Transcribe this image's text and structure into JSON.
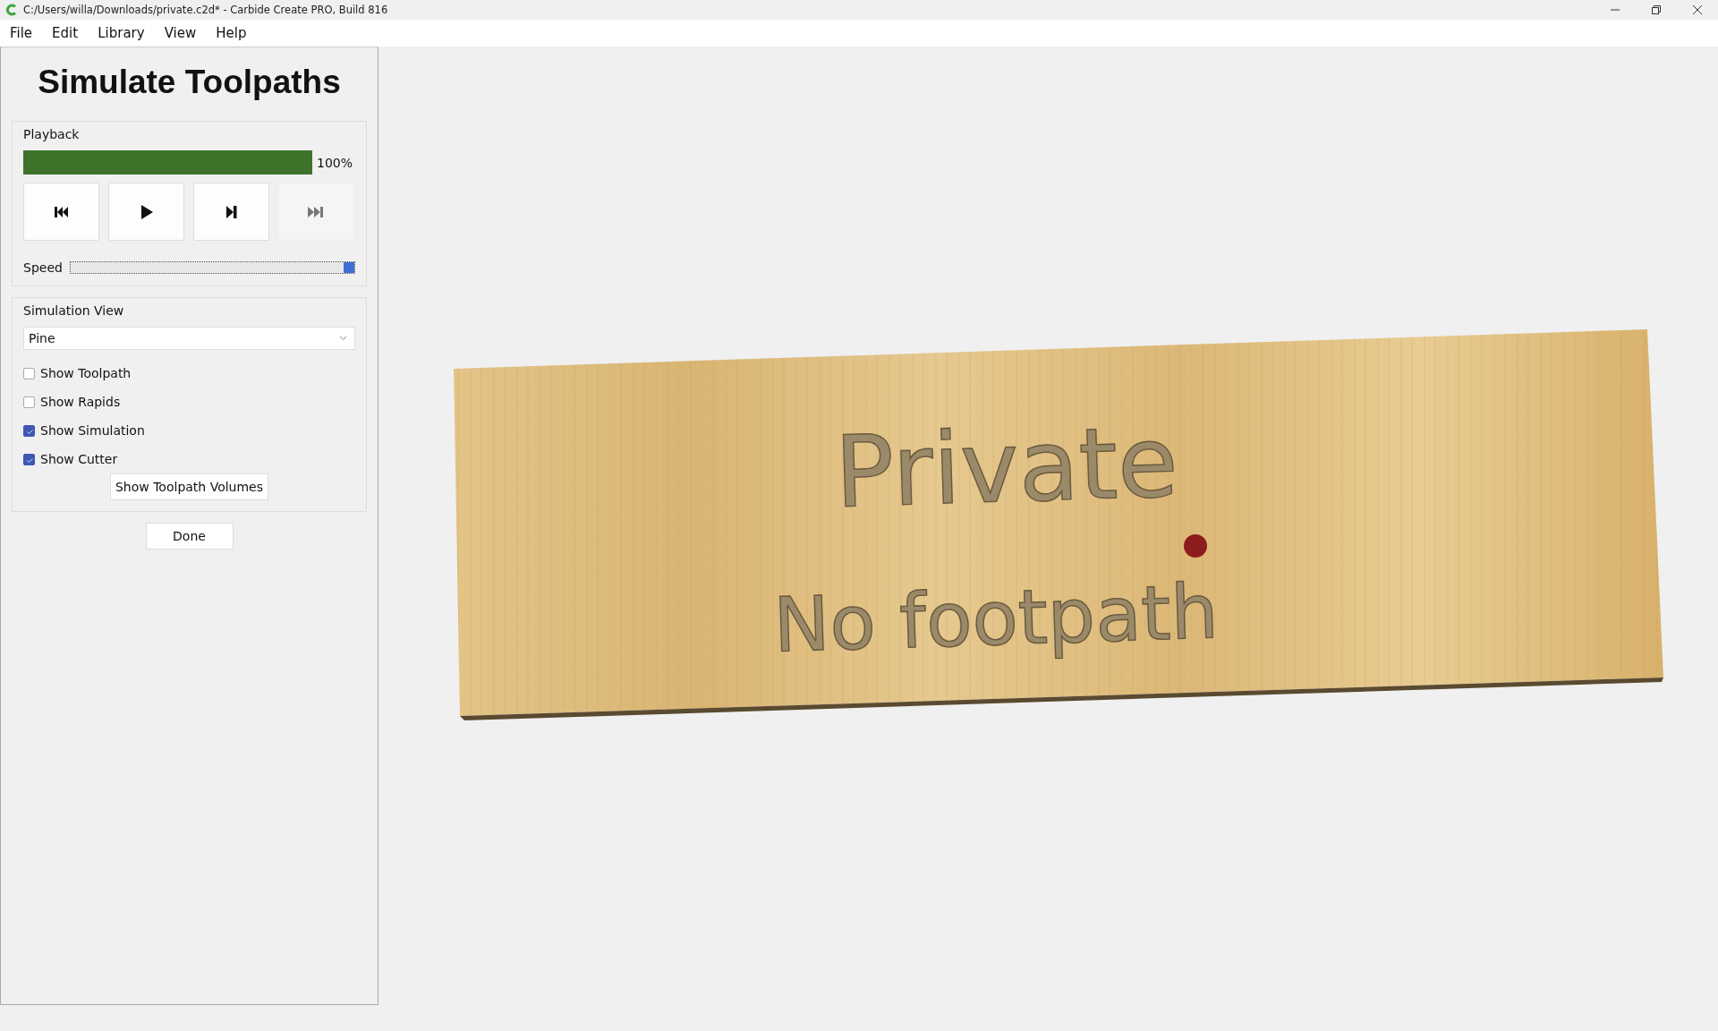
{
  "window": {
    "title": "C:/Users/willa/Downloads/private.c2d* - Carbide Create PRO, Build 816"
  },
  "menu": [
    {
      "label": "File"
    },
    {
      "label": "Edit"
    },
    {
      "label": "Library"
    },
    {
      "label": "View"
    },
    {
      "label": "Help"
    }
  ],
  "panel": {
    "heading": "Simulate Toolpaths",
    "playback": {
      "label": "Playback",
      "progress": {
        "level": 1.0,
        "reading": "100%"
      },
      "buttons": [
        {
          "kind": "rewind",
          "disabled": false
        },
        {
          "kind": "play",
          "disabled": false
        },
        {
          "kind": "step",
          "disabled": false
        },
        {
          "kind": "end",
          "disabled": true
        }
      ],
      "speed": {
        "label": "Speed",
        "level": 1.0
      }
    },
    "simulation_view": {
      "label": "Simulation View",
      "material": {
        "value": "Pine"
      },
      "options": [
        {
          "label": "Show Toolpath",
          "checked": false
        },
        {
          "label": "Show Rapids",
          "checked": false
        },
        {
          "label": "Show Simulation",
          "checked": true
        },
        {
          "label": "Show Cutter",
          "checked": true
        }
      ],
      "volumes_button": "Show Toolpath Volumes"
    },
    "done_button": "Done"
  },
  "viewport": {
    "engraved_text": [
      "Private",
      "No footpath"
    ]
  }
}
